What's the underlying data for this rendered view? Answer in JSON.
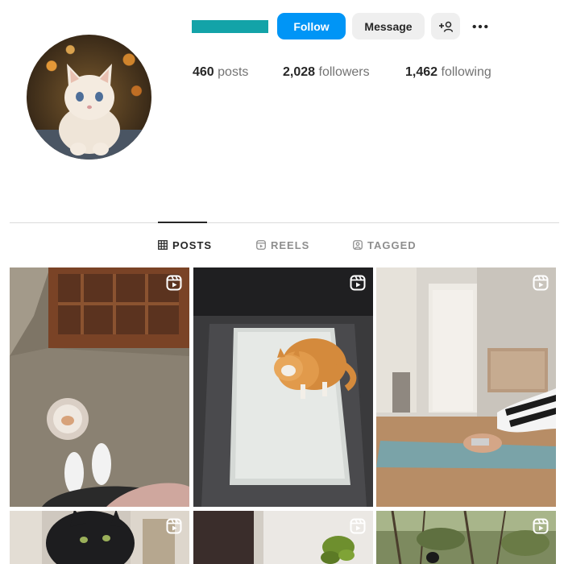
{
  "profile": {
    "stats": [
      {
        "value": "460",
        "label": "posts"
      },
      {
        "value": "2,028",
        "label": "followers"
      },
      {
        "value": "1,462",
        "label": "following"
      }
    ]
  },
  "actions": {
    "follow_label": "Follow",
    "message_label": "Message",
    "add_user_icon": "add-user-icon",
    "more_icon": "more-options-icon"
  },
  "tabs": [
    {
      "label": "POSTS",
      "icon": "grid-icon",
      "active": true
    },
    {
      "label": "REELS",
      "icon": "reels-icon",
      "active": false
    },
    {
      "label": "TAGGED",
      "icon": "tagged-icon",
      "active": false
    }
  ],
  "colors": {
    "accent": "#0095f6",
    "username_redaction": "#13a3a8"
  },
  "grid": {
    "badge_icon": "reel-icon",
    "posts": [
      {
        "kind": "reel"
      },
      {
        "kind": "reel"
      },
      {
        "kind": "reel"
      },
      {
        "kind": "reel"
      },
      {
        "kind": "reel"
      },
      {
        "kind": "reel"
      }
    ]
  }
}
